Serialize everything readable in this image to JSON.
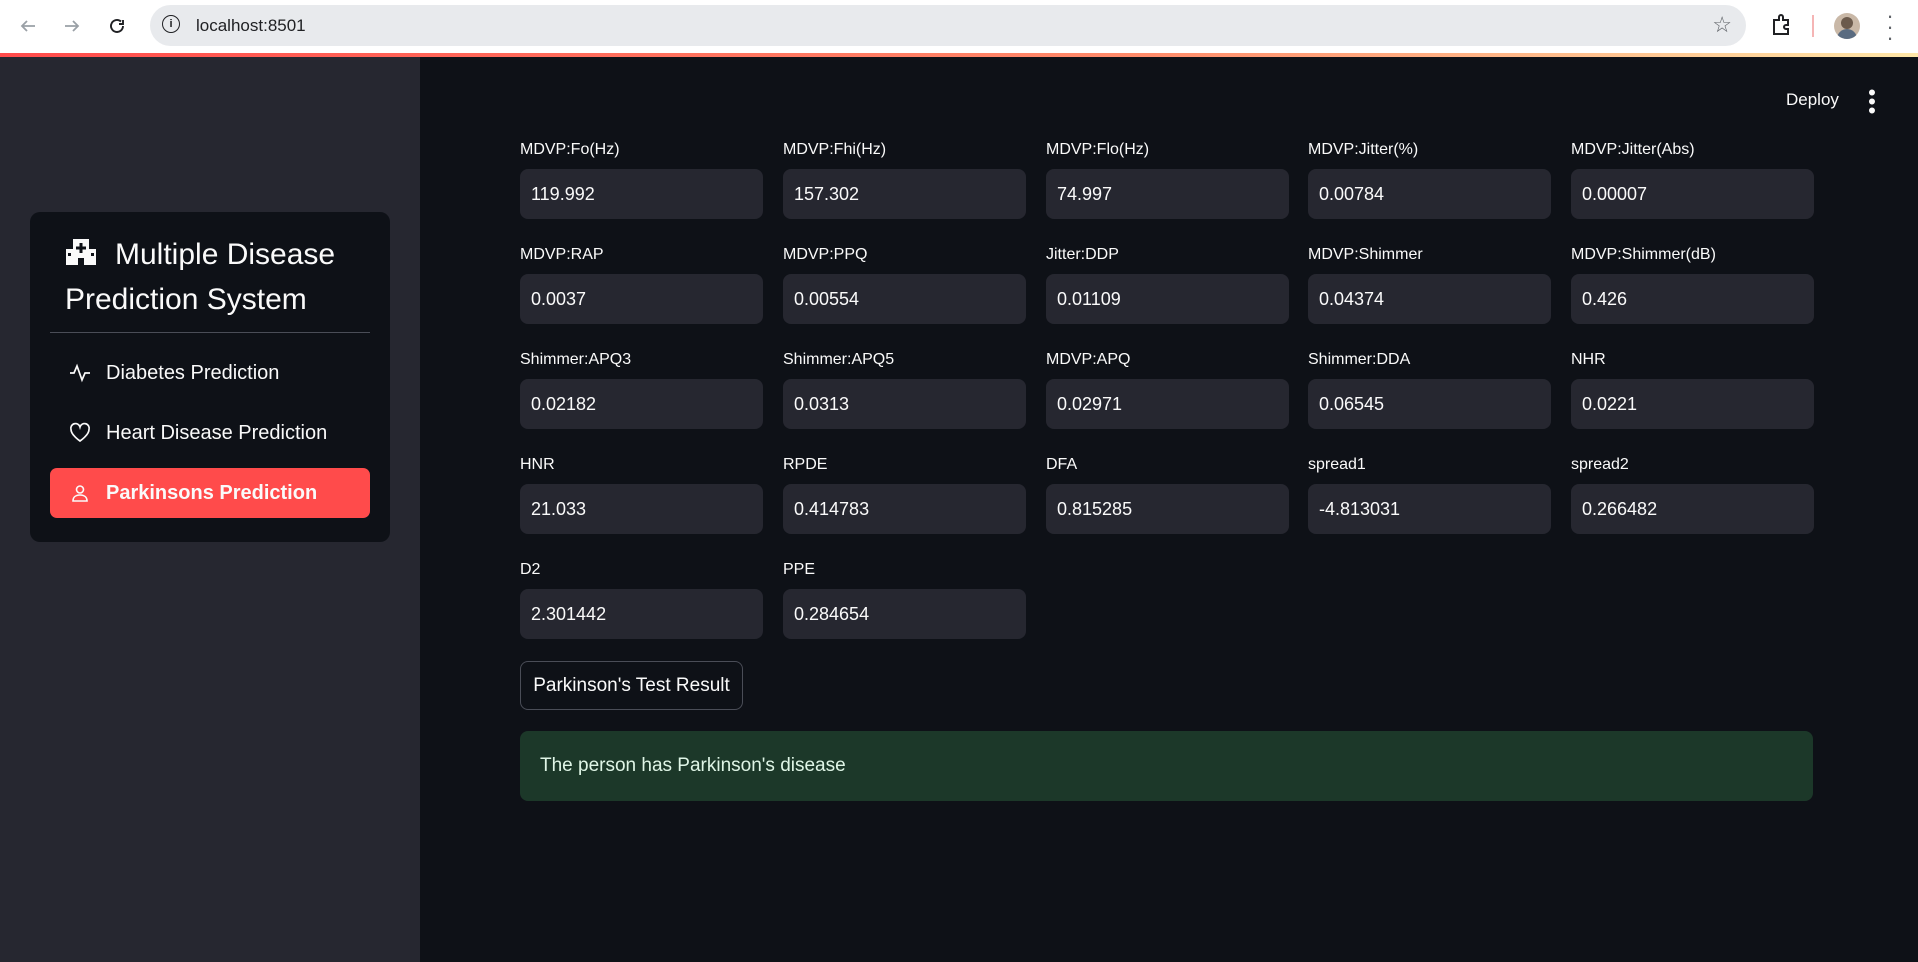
{
  "browser": {
    "url": "localhost:8501",
    "icons": [
      "back-arrow-icon",
      "forward-arrow-icon",
      "reload-icon",
      "info-icon",
      "star-icon",
      "extensions-icon",
      "profile-avatar",
      "more-vert-icon"
    ]
  },
  "header": {
    "deploy_label": "Deploy"
  },
  "sidebar": {
    "title": "Multiple Disease Prediction System",
    "items": [
      {
        "label": "Diabetes Prediction",
        "icon": "activity-icon",
        "active": false
      },
      {
        "label": "Heart Disease Prediction",
        "icon": "heart-icon",
        "active": false
      },
      {
        "label": "Parkinsons Prediction",
        "icon": "person-icon",
        "active": true
      }
    ]
  },
  "fields": [
    {
      "label": "MDVP:Fo(Hz)",
      "value": "119.992"
    },
    {
      "label": "MDVP:Fhi(Hz)",
      "value": "157.302"
    },
    {
      "label": "MDVP:Flo(Hz)",
      "value": "74.997"
    },
    {
      "label": "MDVP:Jitter(%)",
      "value": "0.00784"
    },
    {
      "label": "MDVP:Jitter(Abs)",
      "value": "0.00007"
    },
    {
      "label": "MDVP:RAP",
      "value": "0.0037"
    },
    {
      "label": "MDVP:PPQ",
      "value": "0.00554"
    },
    {
      "label": "Jitter:DDP",
      "value": "0.01109"
    },
    {
      "label": "MDVP:Shimmer",
      "value": "0.04374"
    },
    {
      "label": "MDVP:Shimmer(dB)",
      "value": "0.426"
    },
    {
      "label": "Shimmer:APQ3",
      "value": "0.02182"
    },
    {
      "label": "Shimmer:APQ5",
      "value": "0.0313"
    },
    {
      "label": "MDVP:APQ",
      "value": "0.02971"
    },
    {
      "label": "Shimmer:DDA",
      "value": "0.06545"
    },
    {
      "label": "NHR",
      "value": "0.0221"
    },
    {
      "label": "HNR",
      "value": "21.033"
    },
    {
      "label": "RPDE",
      "value": "0.414783"
    },
    {
      "label": "DFA",
      "value": "0.815285"
    },
    {
      "label": "spread1",
      "value": "-4.813031"
    },
    {
      "label": "spread2",
      "value": "0.266482"
    },
    {
      "label": "D2",
      "value": "2.301442"
    },
    {
      "label": "PPE",
      "value": "0.284654"
    }
  ],
  "result_button_label": "Parkinson's Test Result",
  "result_message": "The person has Parkinson's disease",
  "colors": {
    "accent": "#ff4b4b",
    "sidebar_bg": "#262730",
    "main_bg": "#0e1117",
    "success_bg": "#1c3829"
  }
}
